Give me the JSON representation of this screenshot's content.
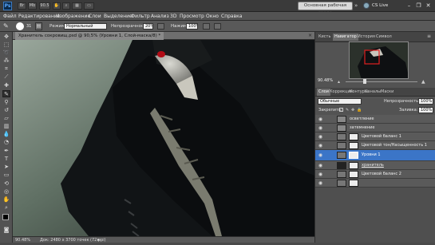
{
  "app": {
    "logo": "Ps",
    "version_badge": "CS5",
    "zoom_menu": "90.5"
  },
  "toolbar_buttons": [
    "Br",
    "Mb"
  ],
  "workspace": {
    "label": "Основная рабочая среда",
    "cs_live": "CS Live"
  },
  "window_controls": [
    "minimize-icon",
    "restore-icon",
    "close-icon"
  ],
  "menu": [
    "Файл",
    "Редактирование",
    "Изображение",
    "Слои",
    "Выделение",
    "Фильтр",
    "Анализ",
    "3D",
    "Просмотр",
    "Окно",
    "Справка"
  ],
  "options": {
    "brush_size": "31",
    "mode_label": "Режим:",
    "mode_value": "Нормальный",
    "opacity_label": "Непрозрачность:",
    "opacity_value": "20%",
    "pressure_label": "Нажим:",
    "pressure_value": "100%"
  },
  "document": {
    "tab_title": "Хранитель сокровищ.psd @ 90,5% (Уровни 1, Слой-маска/8) *",
    "zoom": "90.48%",
    "doc_info": "Док: 2480 x 3700 точек (72 ppi)"
  },
  "panels": {
    "nav_tabs": [
      "Кисть",
      "Навигатор",
      "История",
      "Символ"
    ],
    "nav_zoom": "90.48%",
    "layer_tabs": [
      "Слои",
      "Коррекция",
      "Контуры",
      "Каналы",
      "Маски"
    ],
    "blend_mode": "Обычные",
    "opacity_label": "Непрозрачность:",
    "opacity_value": "100%",
    "lock_label": "Закрепить:",
    "fill_label": "Заливка:",
    "fill_value": "100%",
    "layers": [
      {
        "name": "осветление",
        "selected": false
      },
      {
        "name": "затемнение",
        "selected": false
      },
      {
        "name": "Цветовой баланс 1",
        "selected": false
      },
      {
        "name": "Цветовой тон/Насыщенность 1",
        "selected": false
      },
      {
        "name": "Уровни 1",
        "selected": true
      },
      {
        "name": "хранитель",
        "selected": false
      },
      {
        "name": "Цветовой баланс 2",
        "selected": false
      },
      {
        "name": "",
        "selected": false
      }
    ]
  },
  "colors": {
    "selected_layer": "#3b75c7",
    "ws_button": "#d9d9d9"
  }
}
